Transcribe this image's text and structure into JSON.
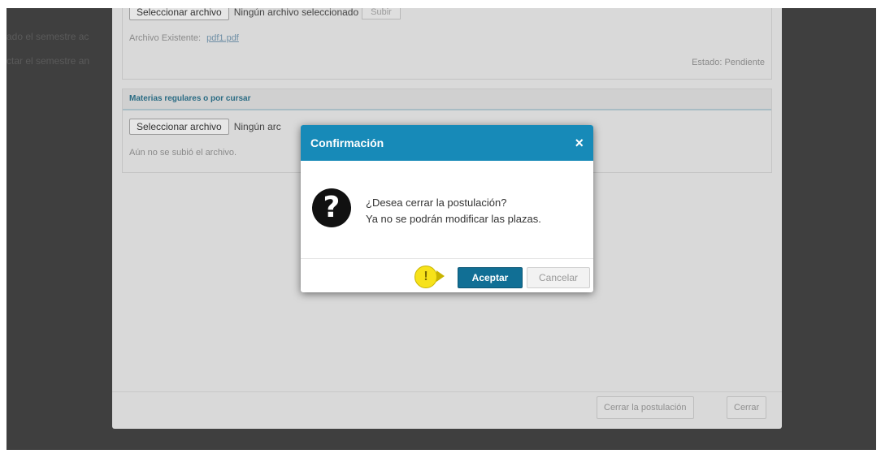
{
  "background": {
    "lines": [
      "ado el semestre ac",
      "ctar el semestre an"
    ]
  },
  "panel1": {
    "file_button": "Seleccionar archivo",
    "file_status": "Ningún archivo seleccionado",
    "upload_button": "Subir",
    "existing_label": "Archivo Existente:",
    "existing_file": "pdf1.pdf",
    "estado": "Estado: Pendiente"
  },
  "panel2": {
    "title": "Materias regulares o por cursar",
    "file_button": "Seleccionar archivo",
    "file_status": "Ningún arc",
    "note": "Aún no se subió el archivo."
  },
  "footer": {
    "close_application": "Cerrar la postulación",
    "close": "Cerrar"
  },
  "dialog": {
    "title": "Confirmación",
    "close_icon": "×",
    "message_line1": "¿Desea cerrar la postulación?",
    "message_line2": "Ya no se podrán modificar las plazas.",
    "question_icon": "?",
    "hint_icon": "!",
    "accept": "Aceptar",
    "cancel": "Cancelar"
  },
  "colors": {
    "dialog_header": "#178ab8",
    "accept_button": "#116f95",
    "hint": "#f7e21a"
  }
}
